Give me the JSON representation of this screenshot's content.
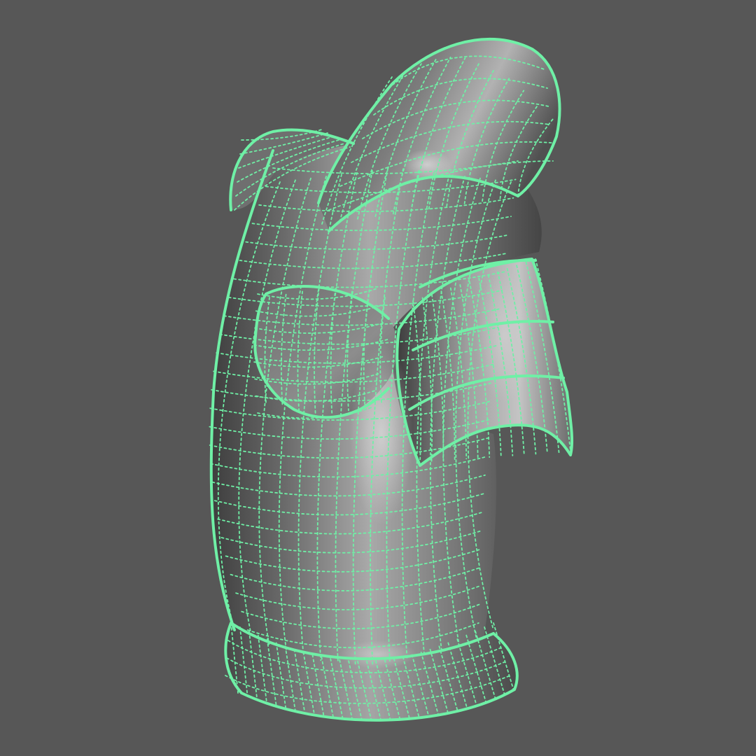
{
  "viewport": {
    "background_color": "#575757",
    "shading": "smooth-shaded-with-wireframe-on-shaded",
    "selection_highlighted": true
  },
  "model": {
    "kind": "nurbs-surface-torso-armor-piece",
    "selected": true,
    "surface_color": "#8a8a8a",
    "wireframe_color": "#6ff0a6",
    "wireframe_style": "dotted-isoparms-with-solid-edges",
    "parts": [
      {
        "name": "torso-shell",
        "icon": "surface-icon"
      },
      {
        "name": "shoulder-pauldron",
        "icon": "surface-icon"
      },
      {
        "name": "collar",
        "icon": "surface-icon"
      },
      {
        "name": "chest-plate",
        "icon": "surface-icon"
      },
      {
        "name": "waist-rim",
        "icon": "surface-icon"
      }
    ]
  }
}
